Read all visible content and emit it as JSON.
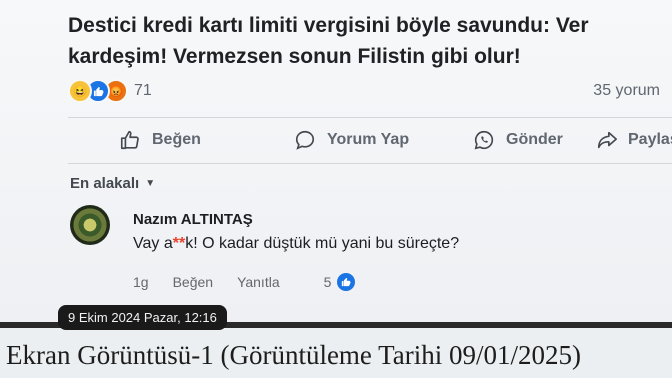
{
  "post": {
    "title": "Destici  kredi kartı limiti vergisini  böyle savundu: Ver kardeşim! Vermezsen sonun  Filistin gibi olur!",
    "reaction_count": "71",
    "comment_count": "35 yorum"
  },
  "actions": {
    "like": "Beğen",
    "comment": "Yorum Yap",
    "send": "Gönder",
    "share": "Paylaş"
  },
  "comments": {
    "sort_label": "En alakalı",
    "author": "Nazım ALTINTAŞ",
    "text_before": "Vay a",
    "text_censored": "**",
    "text_after": "k!  O kadar düştük mü yani bu süreçte?",
    "time": "1g",
    "like": "Beğen",
    "reply": "Yanıtla",
    "like_count": "5"
  },
  "overlay": {
    "timestamp": "9 Ekim 2024 Pazar, 12:16"
  },
  "caption": {
    "text": "Ekran Görüntüsü-1 (Görüntüleme Tarihi 09/01/2025)"
  },
  "colors": {
    "accent": "#1b74e4",
    "haha": "#f7c33b",
    "angry": "#e9710f"
  },
  "icons": [
    "haha-icon",
    "like-icon",
    "angry-icon",
    "thumbs-up-icon",
    "comment-icon",
    "whatsapp-icon",
    "share-icon",
    "caret-down-icon"
  ]
}
